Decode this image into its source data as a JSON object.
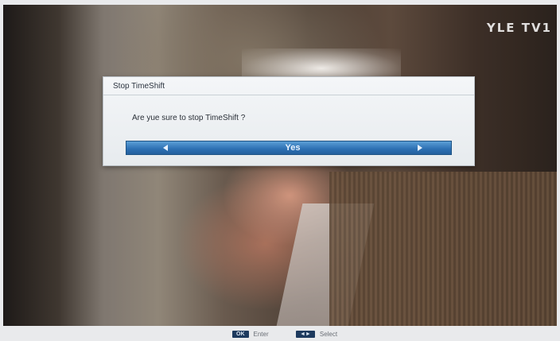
{
  "channel": {
    "logo": "YLE TV1"
  },
  "dialog": {
    "title": "Stop TimeShift",
    "message": "Are yue sure to stop TimeShift ?",
    "selection": {
      "value": "Yes",
      "left_icon": "arrow-left-icon",
      "right_icon": "arrow-right-icon"
    }
  },
  "hints": [
    {
      "key": "OK",
      "label": "Enter"
    },
    {
      "key": "◄►",
      "label": "Select"
    }
  ],
  "colors": {
    "select_bar": "#2c6fb2",
    "dialog_bg": "#eef1f4",
    "key_bg": "#1d3a5e"
  }
}
